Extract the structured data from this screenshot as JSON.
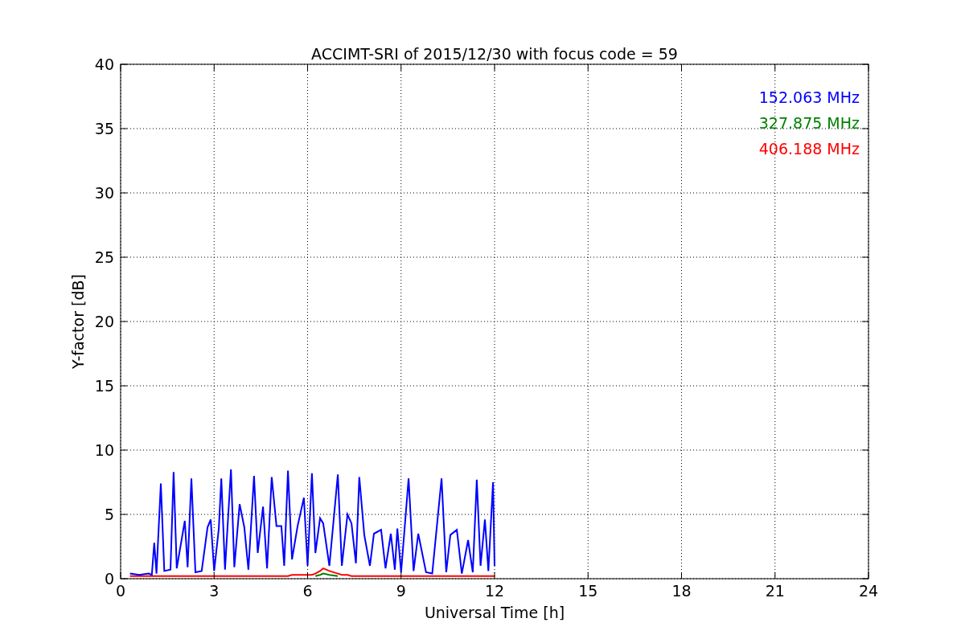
{
  "chart_data": {
    "type": "line",
    "title": "ACCIMT-SRI of 2015/12/30 with focus code = 59",
    "xlabel": "Universal Time [h]",
    "ylabel": "Y-factor [dB]",
    "xlim": [
      0,
      24
    ],
    "ylim": [
      0,
      40
    ],
    "xticks": [
      0,
      3,
      6,
      9,
      12,
      15,
      18,
      21,
      24
    ],
    "yticks": [
      0,
      5,
      10,
      15,
      20,
      25,
      30,
      35,
      40
    ],
    "grid": true,
    "x": [
      0.3,
      0.6,
      0.9,
      1.0,
      1.08,
      1.15,
      1.29,
      1.4,
      1.6,
      1.7,
      1.8,
      2.06,
      2.15,
      2.27,
      2.4,
      2.6,
      2.79,
      2.89,
      3.0,
      3.15,
      3.23,
      3.35,
      3.54,
      3.65,
      3.82,
      3.97,
      4.1,
      4.28,
      4.4,
      4.57,
      4.7,
      4.85,
      5.0,
      5.16,
      5.25,
      5.37,
      5.5,
      5.68,
      5.88,
      6.0,
      6.14,
      6.25,
      6.4,
      6.5,
      6.7,
      6.97,
      7.1,
      7.28,
      7.41,
      7.55,
      7.66,
      7.82,
      8.0,
      8.13,
      8.36,
      8.5,
      8.67,
      8.8,
      8.88,
      9.0,
      9.24,
      9.4,
      9.55,
      9.8,
      10.0,
      10.3,
      10.45,
      10.58,
      10.79,
      10.95,
      11.15,
      11.3,
      11.43,
      11.55,
      11.69,
      11.8,
      11.95,
      12.0
    ],
    "series": [
      {
        "name": "152.063 MHz",
        "color": "#0000ff",
        "values": [
          0.4,
          0.3,
          0.4,
          0.3,
          2.8,
          0.4,
          7.4,
          0.6,
          0.7,
          8.3,
          0.8,
          4.5,
          0.9,
          7.8,
          0.5,
          0.6,
          4.0,
          4.6,
          0.6,
          3.9,
          7.8,
          0.7,
          8.5,
          0.9,
          5.8,
          4.0,
          0.7,
          8.0,
          2.0,
          5.6,
          0.8,
          7.9,
          4.1,
          4.1,
          1.0,
          8.4,
          1.5,
          4.1,
          6.3,
          1.0,
          8.2,
          2.0,
          4.7,
          4.3,
          1.0,
          8.1,
          1.0,
          5.0,
          4.3,
          1.2,
          7.9,
          3.4,
          1.0,
          3.5,
          3.8,
          0.8,
          3.5,
          0.7,
          3.9,
          0.5,
          7.8,
          0.6,
          3.5,
          0.5,
          0.4,
          7.8,
          0.5,
          3.4,
          3.8,
          0.4,
          3.0,
          0.5,
          7.7,
          1.0,
          4.6,
          0.6,
          7.5,
          1.0
        ]
      },
      {
        "name": "327.875 MHz",
        "color": "#008000",
        "values": [
          null,
          null,
          null,
          null,
          null,
          null,
          null,
          null,
          null,
          null,
          null,
          null,
          null,
          null,
          null,
          null,
          null,
          null,
          null,
          null,
          null,
          null,
          null,
          null,
          null,
          null,
          null,
          null,
          null,
          null,
          null,
          null,
          null,
          null,
          null,
          null,
          null,
          null,
          null,
          null,
          null,
          0.2,
          0.3,
          0.4,
          0.3,
          0.2,
          null,
          null,
          null,
          null,
          null,
          null,
          null,
          null,
          null,
          null,
          null,
          null,
          null,
          null,
          null,
          null,
          null,
          null,
          null,
          null,
          null,
          null,
          null,
          null,
          null,
          null,
          null,
          null,
          null,
          null,
          null,
          null
        ]
      },
      {
        "name": "406.188 MHz",
        "color": "#ff0000",
        "values": [
          0.2,
          0.2,
          0.2,
          0.2,
          0.2,
          0.2,
          0.2,
          0.2,
          0.2,
          0.2,
          0.2,
          0.2,
          0.2,
          0.2,
          0.2,
          0.2,
          0.2,
          0.2,
          0.2,
          0.2,
          0.2,
          0.2,
          0.2,
          0.2,
          0.2,
          0.2,
          0.2,
          0.2,
          0.2,
          0.2,
          0.2,
          0.2,
          0.2,
          0.2,
          0.2,
          0.2,
          0.3,
          0.3,
          0.3,
          0.3,
          0.3,
          0.4,
          0.6,
          0.8,
          0.6,
          0.4,
          0.3,
          0.3,
          0.2,
          0.2,
          0.2,
          0.2,
          0.2,
          0.2,
          0.2,
          0.2,
          0.2,
          0.2,
          0.2,
          0.2,
          0.2,
          0.2,
          0.2,
          0.2,
          0.2,
          0.2,
          0.2,
          0.2,
          0.2,
          0.2,
          0.2,
          0.2,
          0.2,
          0.2,
          0.2,
          0.2,
          0.2,
          0.2
        ]
      }
    ]
  }
}
